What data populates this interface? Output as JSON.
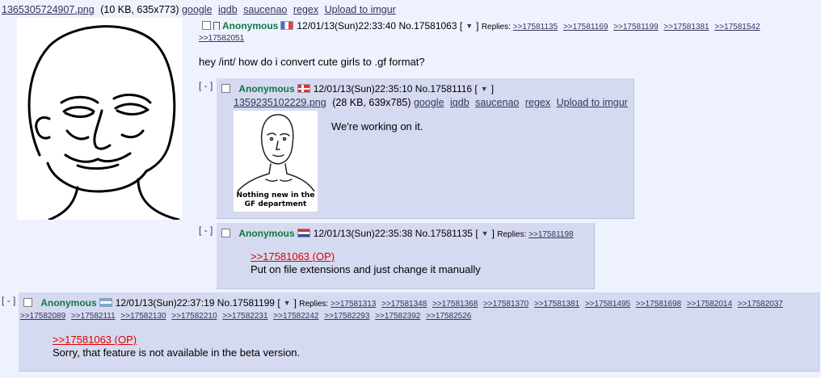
{
  "op": {
    "file": {
      "name": "1365305724907.png",
      "meta": "(10 KB, 635x773)",
      "links": [
        "google",
        "iqdb",
        "saucenao",
        "regex",
        "Upload to imgur"
      ]
    },
    "name": "Anonymous",
    "datetime": "12/01/13(Sun)22:33:40",
    "no": "No.17581063",
    "menu": "▼",
    "replies_label": "Replies:",
    "replies": [
      ">>17581135",
      ">>17581169",
      ">>17581199",
      ">>17581381",
      ">>17581542",
      ">>17582051"
    ],
    "message": "hey /int/ how do i convert cute girls to .gf format?"
  },
  "reply1": {
    "expand": "[ - ]",
    "name": "Anonymous",
    "datetime": "12/01/13(Sun)22:35:10",
    "no": "No.17581116",
    "menu": "▼",
    "file": {
      "name": "1359235102229.png",
      "meta": "(28 KB, 639x785)",
      "links": [
        "google",
        "iqdb",
        "saucenao",
        "regex",
        "Upload to imgur"
      ]
    },
    "thumb_caption_line1": "Nothing new in the",
    "thumb_caption_line2": "GF department",
    "message": "We're working on it."
  },
  "reply2": {
    "expand": "[ - ]",
    "name": "Anonymous",
    "datetime": "12/01/13(Sun)22:35:38",
    "no": "No.17581135",
    "menu": "▼",
    "replies_label": "Replies:",
    "replies": [
      ">>17581198"
    ],
    "quote": ">>17581063 (OP)",
    "message": "Put on file extensions and just change it manually"
  },
  "reply3": {
    "expand": "[ - ]",
    "name": "Anonymous",
    "datetime": "12/01/13(Sun)22:37:19",
    "no": "No.17581199",
    "menu": "▼",
    "replies_label": "Replies:",
    "replies": [
      ">>17581313",
      ">>17581348",
      ">>17581368",
      ">>17581370",
      ">>17581381",
      ">>17581495",
      ">>17581698",
      ">>17582014",
      ">>17582037",
      ">>17582089",
      ">>17582111",
      ">>17582130",
      ">>17582210",
      ">>17582231",
      ">>17582242",
      ">>17582293",
      ">>17582392",
      ">>17582526"
    ],
    "quote": ">>17581063 (OP)",
    "message": "Sorry, that feature is not available in the beta version."
  }
}
